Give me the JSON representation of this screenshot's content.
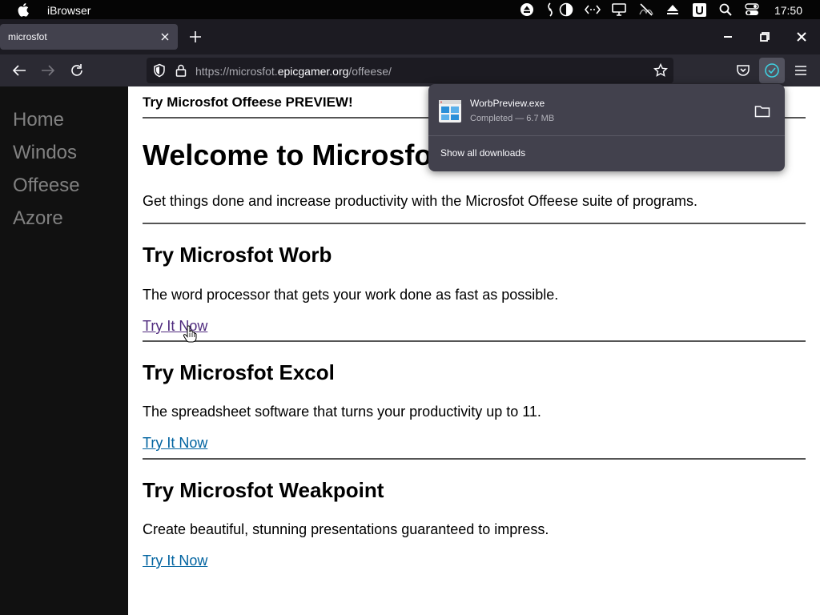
{
  "menubar": {
    "app_name": "iBrowser",
    "clock": "17:50",
    "tray_icons": [
      "eject-icon",
      "audio-icon",
      "contrast-icon",
      "code-icon",
      "display-icon",
      "mute-icon",
      "upload-icon",
      "u-icon",
      "search-icon",
      "toggle-icon"
    ]
  },
  "tabs": [
    {
      "title": "microsfot",
      "active": true
    }
  ],
  "navbar": {
    "url_prefix": "https://microsfot.",
    "url_host": "epicgamer.org",
    "url_path": "/offeese/"
  },
  "sidebar": {
    "items": [
      "Home",
      "Windos",
      "Offeese",
      "Azore"
    ]
  },
  "page": {
    "preview_banner": "Try Microsfot Offeese PREVIEW!",
    "heading": "Welcome to Microsfot Offeese",
    "intro": "Get things done and increase productivity with the Microsfot Offeese suite of programs.",
    "sections": [
      {
        "title": "Try Microsfot Worb",
        "desc": "The word processor that gets your work done as fast as possible.",
        "link": "Try It Now",
        "visited": true
      },
      {
        "title": "Try Microsfot Excol",
        "desc": "The spreadsheet software that turns your productivity up to 11.",
        "link": "Try It Now",
        "visited": false
      },
      {
        "title": "Try Microsfot Weakpoint",
        "desc": "Create beautiful, stunning presentations guaranteed to impress.",
        "link": "Try It Now",
        "visited": false
      }
    ]
  },
  "downloads": {
    "items": [
      {
        "filename": "WorbPreview.exe",
        "status": "Completed — 6.7 MB"
      }
    ],
    "show_all": "Show all downloads"
  },
  "colors": {
    "accent": "#3fd0e0",
    "link": "#0063a0",
    "link_visited": "#4f2a7e",
    "sidebar_bg": "#111111",
    "sidebar_text": "#818181"
  }
}
